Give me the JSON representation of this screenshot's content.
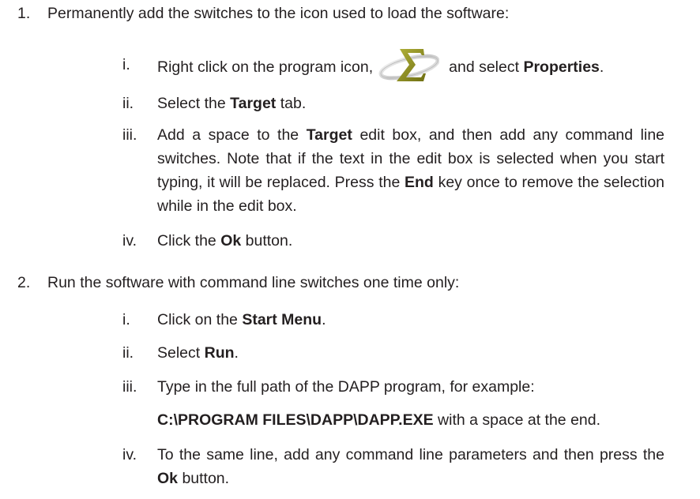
{
  "steps": [
    {
      "number": "1.",
      "text": "Permanently add the switches to the icon used to load the software:",
      "substeps": [
        {
          "numeral": "i.",
          "before_icon": "Right click on the program icon,",
          "icon": "sigma-program-icon",
          "after_icon": "and select",
          "bold": "Properties",
          "end": "."
        },
        {
          "numeral": "ii.",
          "before": "Select the",
          "bold": "Target",
          "after": "tab."
        },
        {
          "numeral": "iii.",
          "before": "Add a space to the",
          "bold1": "Target",
          "middle": "edit box, and then add any command line switches. Note that if the text in the edit box is selected when you start typing, it will be replaced. Press the",
          "bold2": "End",
          "after": "key once to remove the selection while in the edit box."
        },
        {
          "numeral": "iv.",
          "before": "Click the",
          "bold": "Ok",
          "after": "button."
        }
      ]
    },
    {
      "number": "2.",
      "text": "Run the software with command line switches one time only:",
      "substeps": [
        {
          "numeral": "i.",
          "before": "Click on the",
          "bold": "Start Menu",
          "after": "."
        },
        {
          "numeral": "ii.",
          "before": "Select",
          "bold": "Run",
          "after": "."
        },
        {
          "numeral": "iii.",
          "text": "Type in the full path of the DAPP program, for example:",
          "path": "C:\\PROGRAM FILES\\DAPP\\DAPP.EXE",
          "path_after": "with a space at the end."
        },
        {
          "numeral": "iv.",
          "before": "To the same line, add any command line parameters and then press the",
          "bold": "Ok",
          "after": "button."
        }
      ]
    }
  ],
  "colors": {
    "text": "#231f20",
    "icon_olive": "#8c8c1c"
  }
}
